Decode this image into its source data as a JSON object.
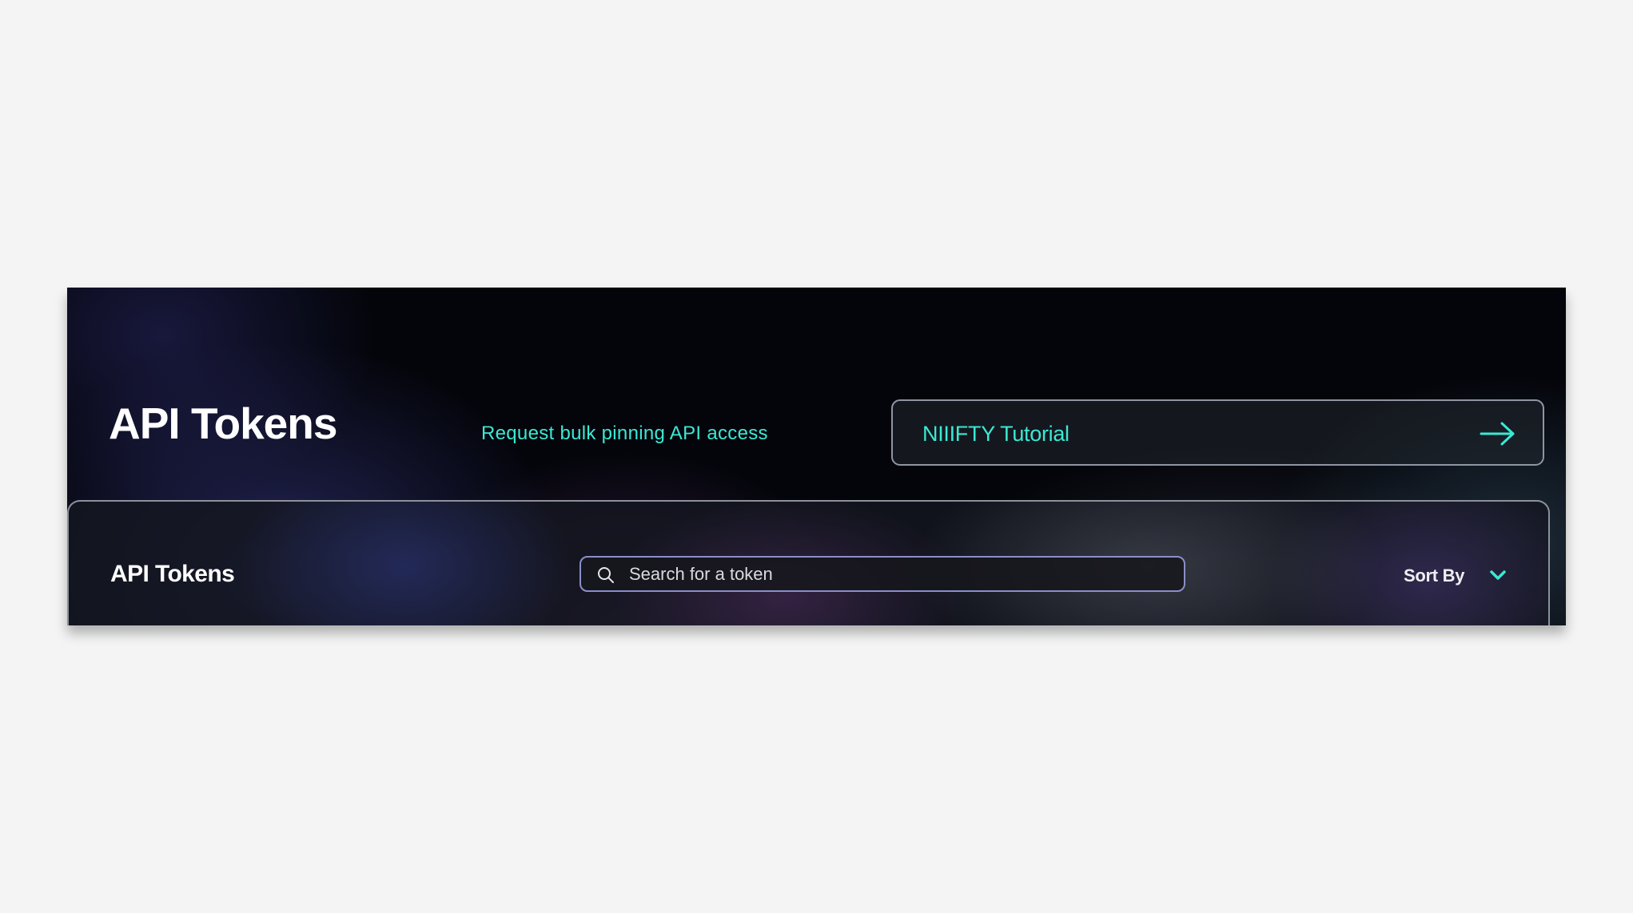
{
  "header": {
    "title": "API Tokens",
    "bulk_link_label": "Request bulk pinning API access",
    "tutorial_button_label": "NIIIFTY Tutorial"
  },
  "tokens_card": {
    "title": "API Tokens",
    "search": {
      "placeholder": "Search for a token",
      "value": ""
    },
    "sort": {
      "label": "Sort By"
    }
  },
  "icons": {
    "tutorial_arrow": "arrow-right-icon",
    "search": "search-icon",
    "sort": "chevron-down-icon"
  },
  "colors": {
    "accent": "#3ce8d4",
    "page_background": "#f3f4f3",
    "panel_background": "#04050b",
    "title_text": "#ffffff"
  }
}
